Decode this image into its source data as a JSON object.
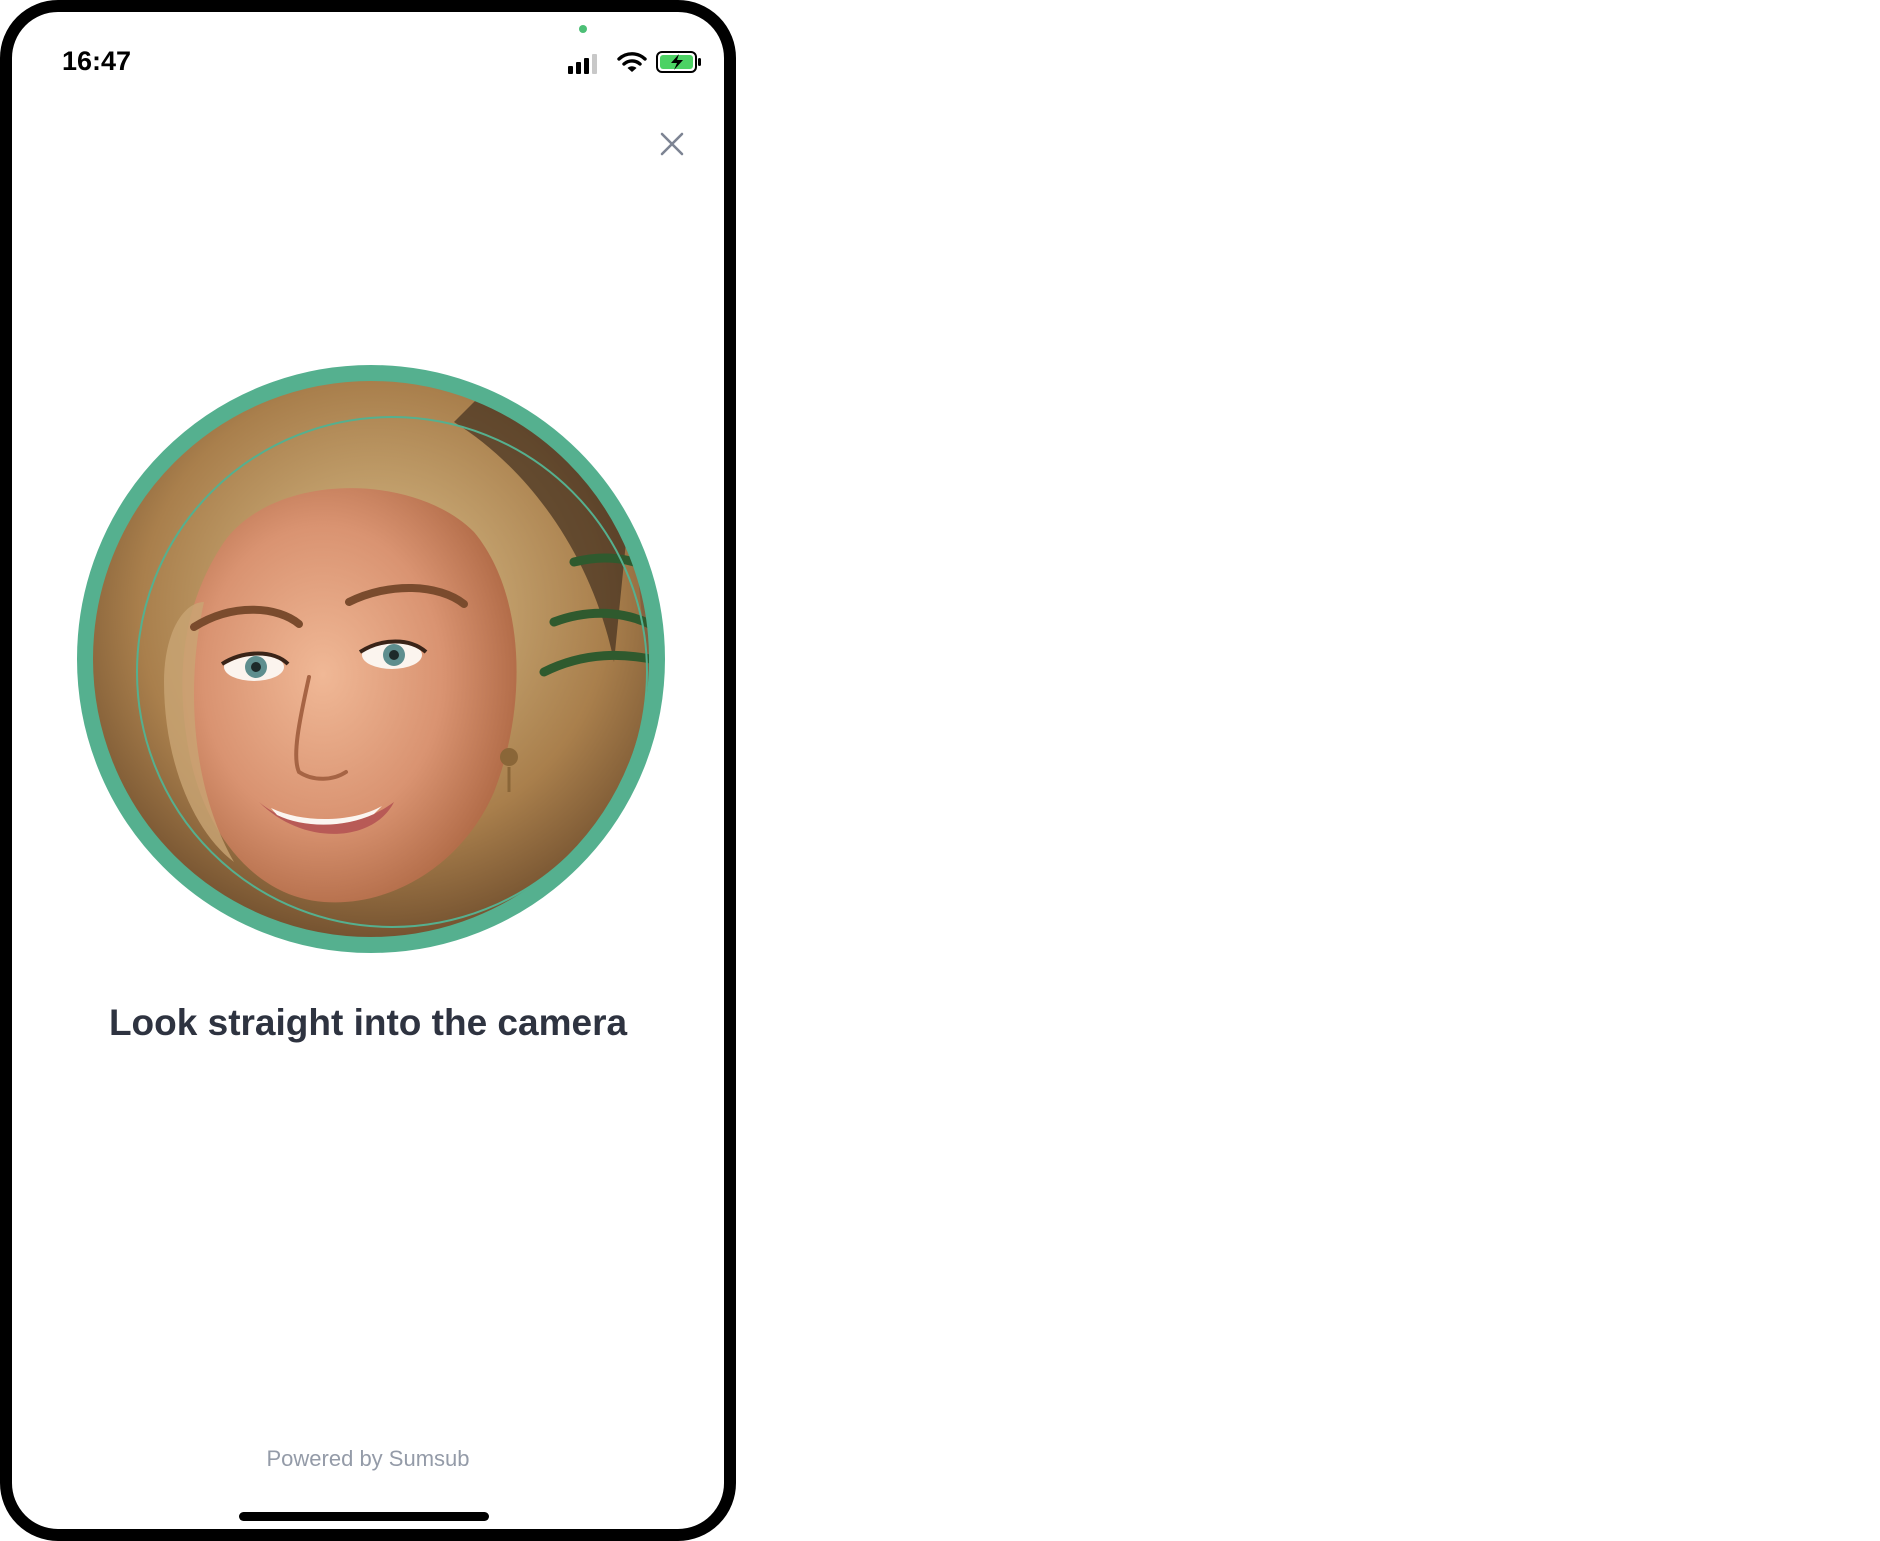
{
  "status_bar": {
    "time": "16:47"
  },
  "colors": {
    "accent": "#55b08f",
    "camera_dot": "#4cbf76",
    "battery_fill": "#4cd264",
    "text": "#2e3340",
    "muted": "#949ba8"
  },
  "icons": {
    "close": "close-icon",
    "signal": "signal-icon",
    "wifi": "wifi-icon",
    "battery": "battery-charging-icon"
  },
  "main": {
    "instruction": "Look straight into the camera"
  },
  "footer": {
    "powered_by": "Powered by Sumsub"
  }
}
